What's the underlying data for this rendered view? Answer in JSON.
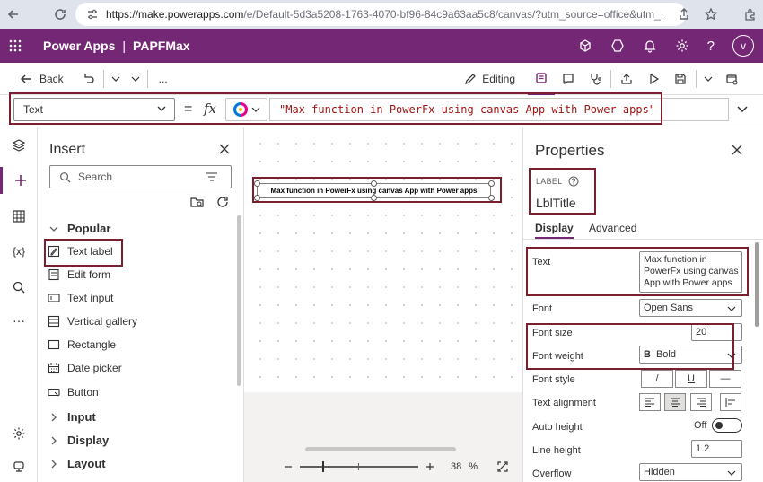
{
  "browser": {
    "url_host": "https://make.powerapps.com",
    "url_rest": "/e/Default-5d3a5208-1763-4070-bf96-84c9a63aa5c8/canvas/?utm_source=office&utm_..."
  },
  "appbar": {
    "product": "Power Apps",
    "separator": "|",
    "app_name": "PAPFMax",
    "avatar_initial": "v",
    "color": "#742774"
  },
  "commandbar": {
    "back_label": "Back",
    "more_label": "...",
    "editing_label": "Editing"
  },
  "formulabar": {
    "property": "Text",
    "equals": "=",
    "fx": "fx",
    "formula": "\"Max function in  PowerFx using canvas App with Power apps\""
  },
  "insert_pane": {
    "title": "Insert",
    "search_placeholder": "Search",
    "categories": {
      "popular": "Popular",
      "input": "Input",
      "display": "Display",
      "layout": "Layout"
    },
    "items": [
      {
        "label": "Text label",
        "icon": "text-label-icon"
      },
      {
        "label": "Edit form",
        "icon": "edit-form-icon"
      },
      {
        "label": "Text input",
        "icon": "text-input-icon"
      },
      {
        "label": "Vertical gallery",
        "icon": "gallery-icon"
      },
      {
        "label": "Rectangle",
        "icon": "rectangle-icon"
      },
      {
        "label": "Date picker",
        "icon": "calendar-icon"
      },
      {
        "label": "Button",
        "icon": "button-icon"
      }
    ]
  },
  "canvas": {
    "label_text": "Max function in  PowerFx using canvas App with Power apps",
    "zoom_value": "38",
    "zoom_unit": "%"
  },
  "properties": {
    "title": "Properties",
    "control_type": "LABEL",
    "control_name": "LblTitle",
    "tabs": {
      "display": "Display",
      "advanced": "Advanced"
    },
    "text_label": "Text",
    "text_value": "Max function in PowerFx using canvas App with Power apps",
    "font_label": "Font",
    "font_value": "Open Sans",
    "font_size_label": "Font size",
    "font_size_value": "20",
    "font_weight_label": "Font weight",
    "font_weight_icon": "B",
    "font_weight_value": "Bold",
    "font_style_label": "Font style",
    "font_style_italic": "/",
    "font_style_underline": "U",
    "font_style_strike": "—",
    "text_alignment_label": "Text alignment",
    "auto_height_label": "Auto height",
    "auto_height_value": "Off",
    "line_height_label": "Line height",
    "line_height_value": "1.2",
    "overflow_label": "Overflow",
    "overflow_value": "Hidden"
  },
  "highlight_color": "#7a1f2e"
}
